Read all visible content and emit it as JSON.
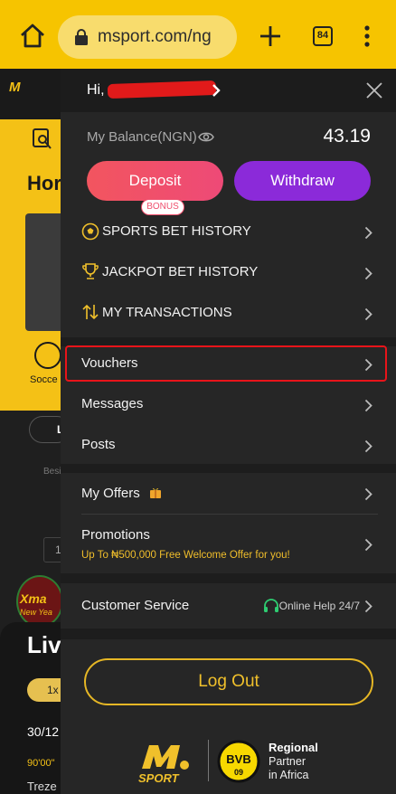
{
  "browser": {
    "url": "msport.com/ng",
    "tab_count": "84"
  },
  "background_app": {
    "home_label": "Hor",
    "soccer_label": "Socce",
    "league_chip": "L",
    "section_hint": "Besi",
    "input_value": "1",
    "xmas_title": "Xma",
    "xmas_sub": "New Yea",
    "live_label": "Liv",
    "pill_label": "1x",
    "date": "30/12",
    "minute": "90'00\"",
    "team": "Treze"
  },
  "drawer": {
    "greeting": "Hi,",
    "balance_label": "My Balance(NGN)",
    "balance_value": "43.19",
    "deposit_label": "Deposit",
    "bonus_badge": "BONUS",
    "withdraw_label": "Withdraw",
    "history": [
      {
        "label": "SPORTS BET HISTORY",
        "icon": "soccer-ball-icon"
      },
      {
        "label": "JACKPOT BET HISTORY",
        "icon": "trophy-icon"
      },
      {
        "label": "MY TRANSACTIONS",
        "icon": "transfer-arrows-icon"
      }
    ],
    "inbox": [
      {
        "label": "Vouchers"
      },
      {
        "label": "Messages"
      },
      {
        "label": "Posts"
      }
    ],
    "my_offers_label": "My Offers",
    "promotions_label": "Promotions",
    "promotions_sub": "Up To ₦500,000 Free Welcome Offer for you!",
    "customer_service_label": "Customer Service",
    "online_help_label": "Online Help 24/7",
    "logout_label": "Log Out",
    "sponsor": {
      "line1": "Regional",
      "line2": "Partner",
      "line3": "in Africa"
    }
  },
  "colors": {
    "browser_bar": "#f6c400",
    "drawer_bg": "#262626",
    "deposit": "#ef4f6d",
    "withdraw": "#8b2ad9",
    "accent_yellow": "#f0c02b",
    "highlight_red": "#e8141a"
  }
}
